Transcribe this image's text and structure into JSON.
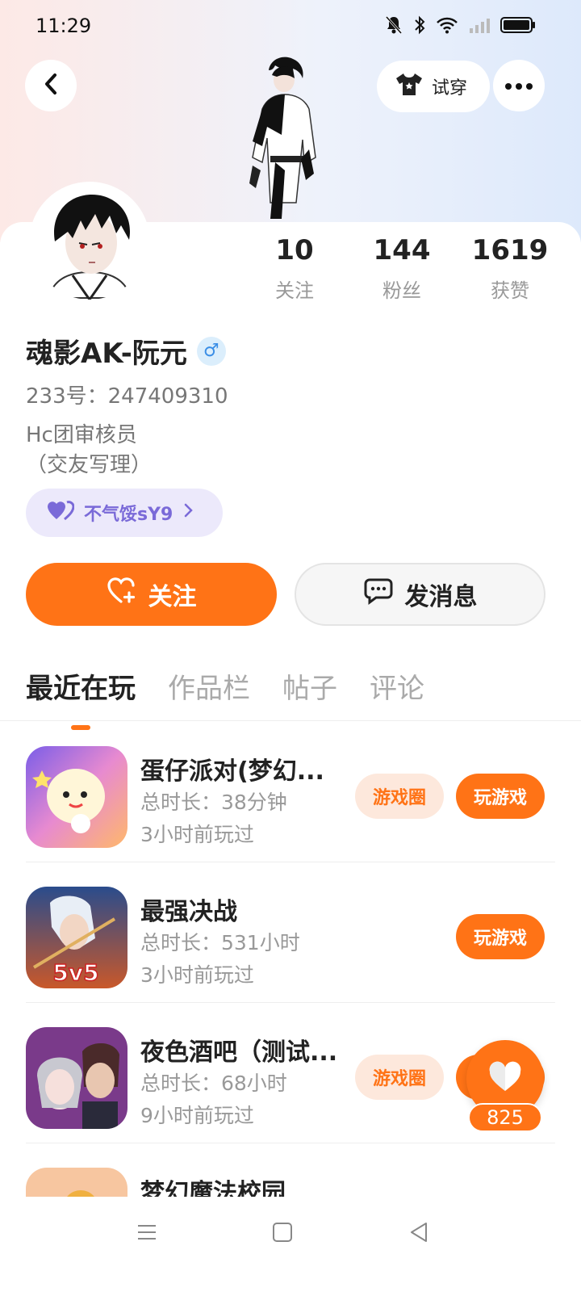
{
  "status_bar": {
    "time": "11:29",
    "icons": [
      "mute-bell-icon",
      "bluetooth-icon",
      "wifi-icon",
      "signal-icon",
      "battery-icon"
    ]
  },
  "header": {
    "back_icon": "chevron-left-icon",
    "tryon_label": "试穿",
    "tryon_icon": "tshirt-icon",
    "more_icon": "ellipsis-icon"
  },
  "profile": {
    "name": "魂影AK-阮元",
    "gender_symbol": "♂",
    "uid": "233号：247409310",
    "bio_line1": "Hc团审核员",
    "bio_line2": "（交友写理）",
    "stats": [
      {
        "value": "10",
        "label": "关注"
      },
      {
        "value": "144",
        "label": "粉丝"
      },
      {
        "value": "1619",
        "label": "获赞"
      }
    ],
    "guild_label": "不气馁sY9"
  },
  "actions": {
    "follow_label": "关注",
    "message_label": "发消息"
  },
  "tabs": [
    {
      "label": "最近在玩",
      "active": true
    },
    {
      "label": "作品栏",
      "active": false
    },
    {
      "label": "帖子",
      "active": false
    },
    {
      "label": "评论",
      "active": false
    }
  ],
  "games": [
    {
      "title": "蛋仔派对(梦幻...",
      "duration": "总时长：38分钟",
      "last_played": "3小时前玩过",
      "circle_label": "游戏圈",
      "play_label": "玩游戏"
    },
    {
      "title": "最强决战",
      "duration": "总时长：531小时",
      "last_played": "3小时前玩过",
      "play_label": "玩游戏"
    },
    {
      "title": "夜色酒吧（测试...",
      "duration": "总时长：68小时",
      "last_played": "9小时前玩过",
      "circle_label": "游戏圈",
      "play_label": "玩游戏"
    },
    {
      "title": "梦幻魔法校园"
    }
  ],
  "like_fab": {
    "count": "825"
  },
  "colors": {
    "accent": "#ff7316",
    "guild": "#7a6ad8"
  }
}
